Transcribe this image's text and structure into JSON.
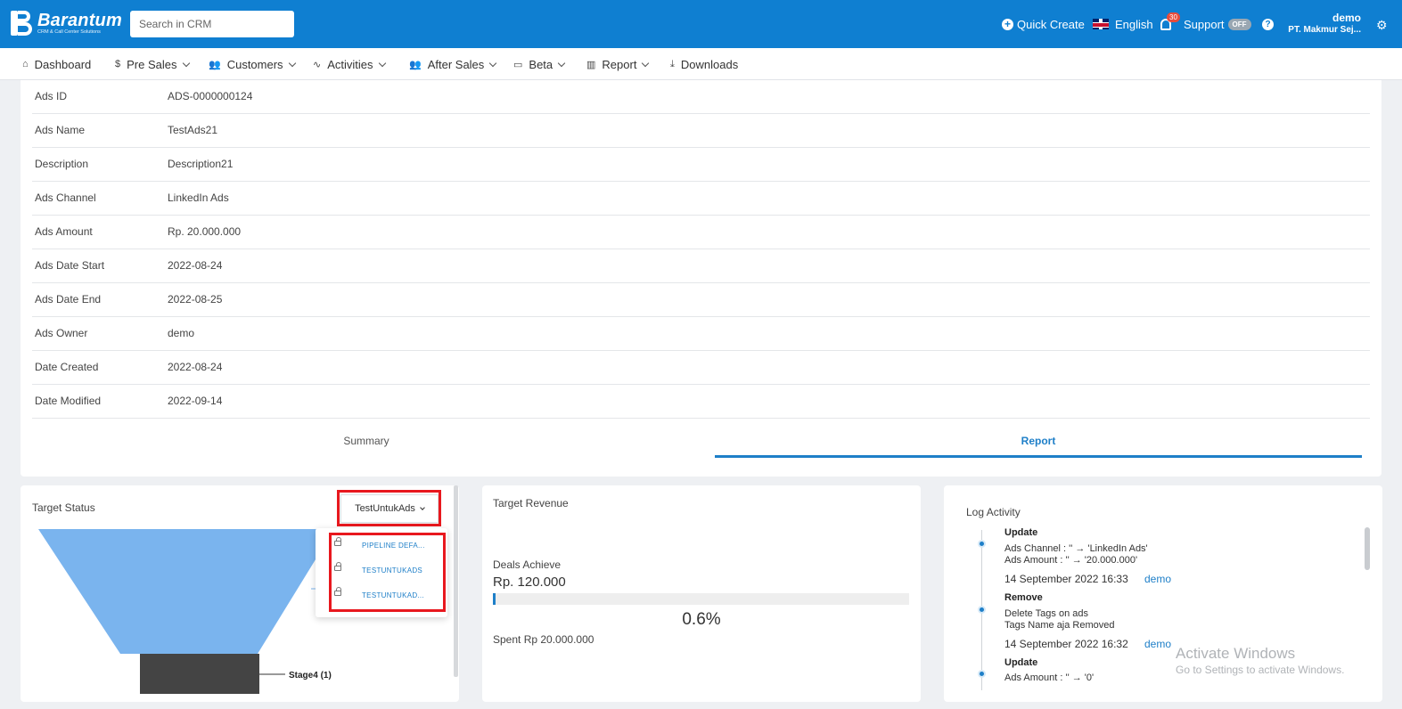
{
  "header": {
    "logo_name": "Barantum",
    "logo_tagline": "CRM & Call Center Solutions",
    "search_placeholder": "Search in CRM",
    "quick_create": "Quick Create",
    "language": "English",
    "notif_count": "30",
    "support": "Support",
    "support_toggle": "OFF",
    "user_name": "demo",
    "company": "PT. Makmur Sej..."
  },
  "nav": {
    "items": [
      {
        "label": "Dashboard",
        "icon": "home-icon"
      },
      {
        "label": "Pre Sales",
        "icon": "dollar-icon"
      },
      {
        "label": "Customers",
        "icon": "users-icon"
      },
      {
        "label": "Activities",
        "icon": "activity-icon"
      },
      {
        "label": "After Sales",
        "icon": "users-icon"
      },
      {
        "label": "Beta",
        "icon": "folder-icon"
      },
      {
        "label": "Report",
        "icon": "bar-chart-icon"
      },
      {
        "label": "Downloads",
        "icon": "download-icon"
      }
    ]
  },
  "details": {
    "rows": [
      {
        "label": "Ads ID",
        "value": "ADS-0000000124"
      },
      {
        "label": "Ads Name",
        "value": "TestAds21"
      },
      {
        "label": "Description",
        "value": "Description21"
      },
      {
        "label": "Ads Channel",
        "value": "LinkedIn Ads"
      },
      {
        "label": "Ads Amount",
        "value": "Rp. 20.000.000"
      },
      {
        "label": "Ads Date Start",
        "value": "2022-08-24"
      },
      {
        "label": "Ads Date End",
        "value": "2022-08-25"
      },
      {
        "label": "Ads Owner",
        "value": "demo"
      },
      {
        "label": "Date Created",
        "value": "2022-08-24"
      },
      {
        "label": "Date Modified",
        "value": "2022-09-14"
      }
    ],
    "tabs": {
      "summary": "Summary",
      "report": "Report"
    }
  },
  "target_status": {
    "title": "Target Status",
    "selected": "TestUntukAds",
    "options": [
      "PIPELINE DEFA...",
      "TESTUNTUKADS",
      "TESTUNTUKAD..."
    ],
    "stage_label": "Stage4 (1)"
  },
  "target_revenue": {
    "title": "Target Revenue",
    "deals_label": "Deals Achieve",
    "deals_amount": "Rp. 120.000",
    "progress": 0.6,
    "percent_text": "0.6%",
    "spent": "Spent Rp 20.000.000"
  },
  "log_activity": {
    "title": "Log Activity",
    "entries": [
      {
        "type": "Update",
        "lines": [
          "Ads Channel : '' → 'LinkedIn Ads'",
          "Ads Amount : '' → '20.000.000'"
        ],
        "date": "14 September 2022 16:33",
        "user": "demo"
      },
      {
        "type": "Remove",
        "lines": [
          "Delete Tags on ads",
          "Tags Name aja Removed"
        ],
        "date": "14 September 2022 16:32",
        "user": "demo"
      },
      {
        "type": "Update",
        "lines": [
          "Ads Amount : '' → '0'"
        ]
      }
    ]
  },
  "watermark": {
    "line1": "Activate Windows",
    "line2": "Go to Settings to activate Windows."
  },
  "colors": {
    "primary": "#0f7fd1",
    "accent": "#1e7fc8",
    "funnel": "#7ab4ee",
    "stage": "#444444",
    "highlight": "#e8181e"
  }
}
